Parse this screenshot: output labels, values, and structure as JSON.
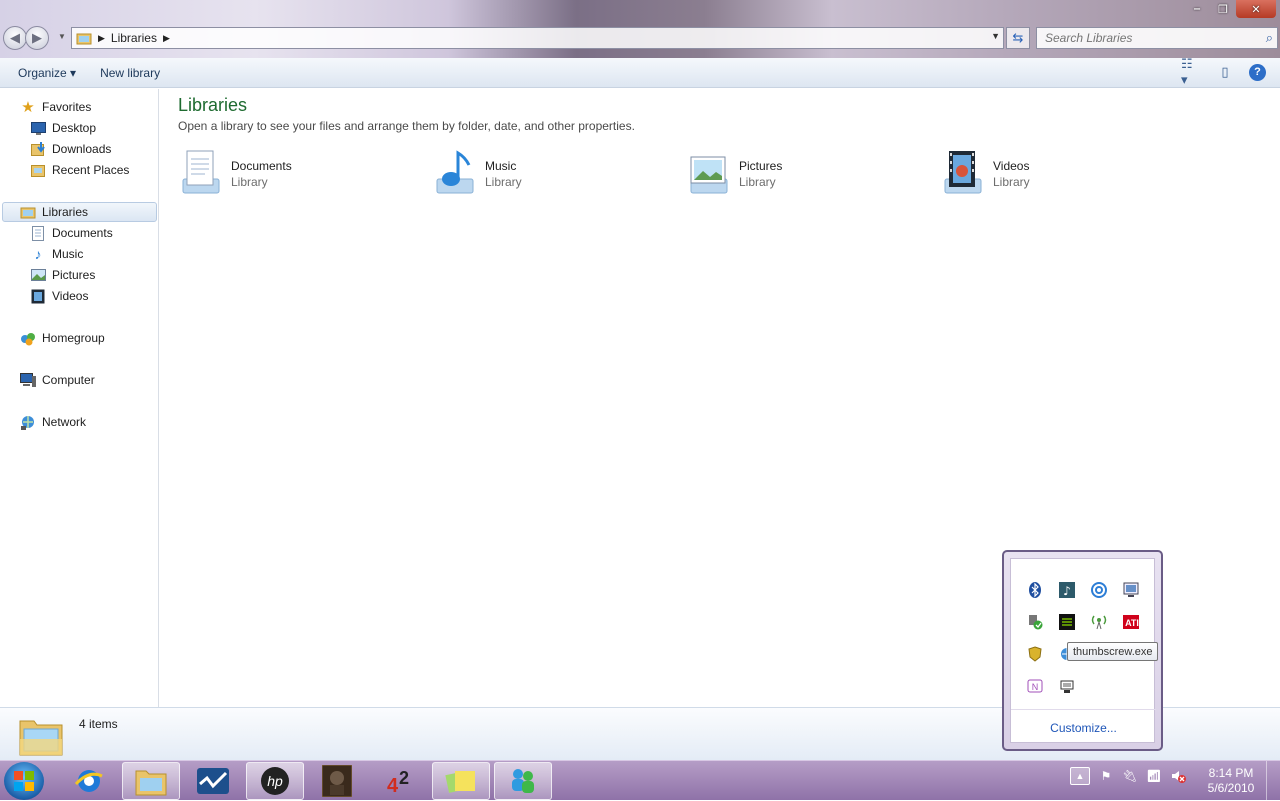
{
  "window": {
    "address": {
      "crumbs": [
        "Libraries"
      ]
    },
    "search": {
      "placeholder": "Search Libraries"
    },
    "controls": {
      "minimize": "‒",
      "maximize": "❐",
      "close": "✕"
    }
  },
  "toolbar": {
    "organize_label": "Organize ▾",
    "new_library_label": "New library"
  },
  "nav": {
    "favorites": {
      "label": "Favorites",
      "items": [
        "Desktop",
        "Downloads",
        "Recent Places"
      ]
    },
    "libraries": {
      "label": "Libraries",
      "items": [
        "Documents",
        "Music",
        "Pictures",
        "Videos"
      ]
    },
    "homegroup": "Homegroup",
    "computer": "Computer",
    "network": "Network"
  },
  "content": {
    "title": "Libraries",
    "subtitle": "Open a library to see your files and arrange them by folder, date, and other properties.",
    "libraries": [
      {
        "name": "Documents",
        "kind": "Library",
        "icon": "documents-library-icon"
      },
      {
        "name": "Music",
        "kind": "Library",
        "icon": "music-library-icon"
      },
      {
        "name": "Pictures",
        "kind": "Library",
        "icon": "pictures-library-icon"
      },
      {
        "name": "Videos",
        "kind": "Library",
        "icon": "videos-library-icon"
      }
    ]
  },
  "status": {
    "item_count": "4 items"
  },
  "tray": {
    "tooltip": "thumbscrew.exe",
    "customize_label": "Customize...",
    "clock_time": "8:14 PM",
    "clock_date": "5/6/2010"
  },
  "taskbar": {
    "apps": [
      "internet-explorer-icon",
      "windows-explorer-icon",
      "activity-monitor-icon",
      "hp-icon",
      "game-portrait-icon",
      "game-4-2-icon",
      "sticky-notes-icon",
      "messenger-icon"
    ]
  },
  "colors": {
    "title_green": "#1e6b30",
    "link_blue": "#1f56b8",
    "taskbar_purple": "#9a7fb2"
  }
}
